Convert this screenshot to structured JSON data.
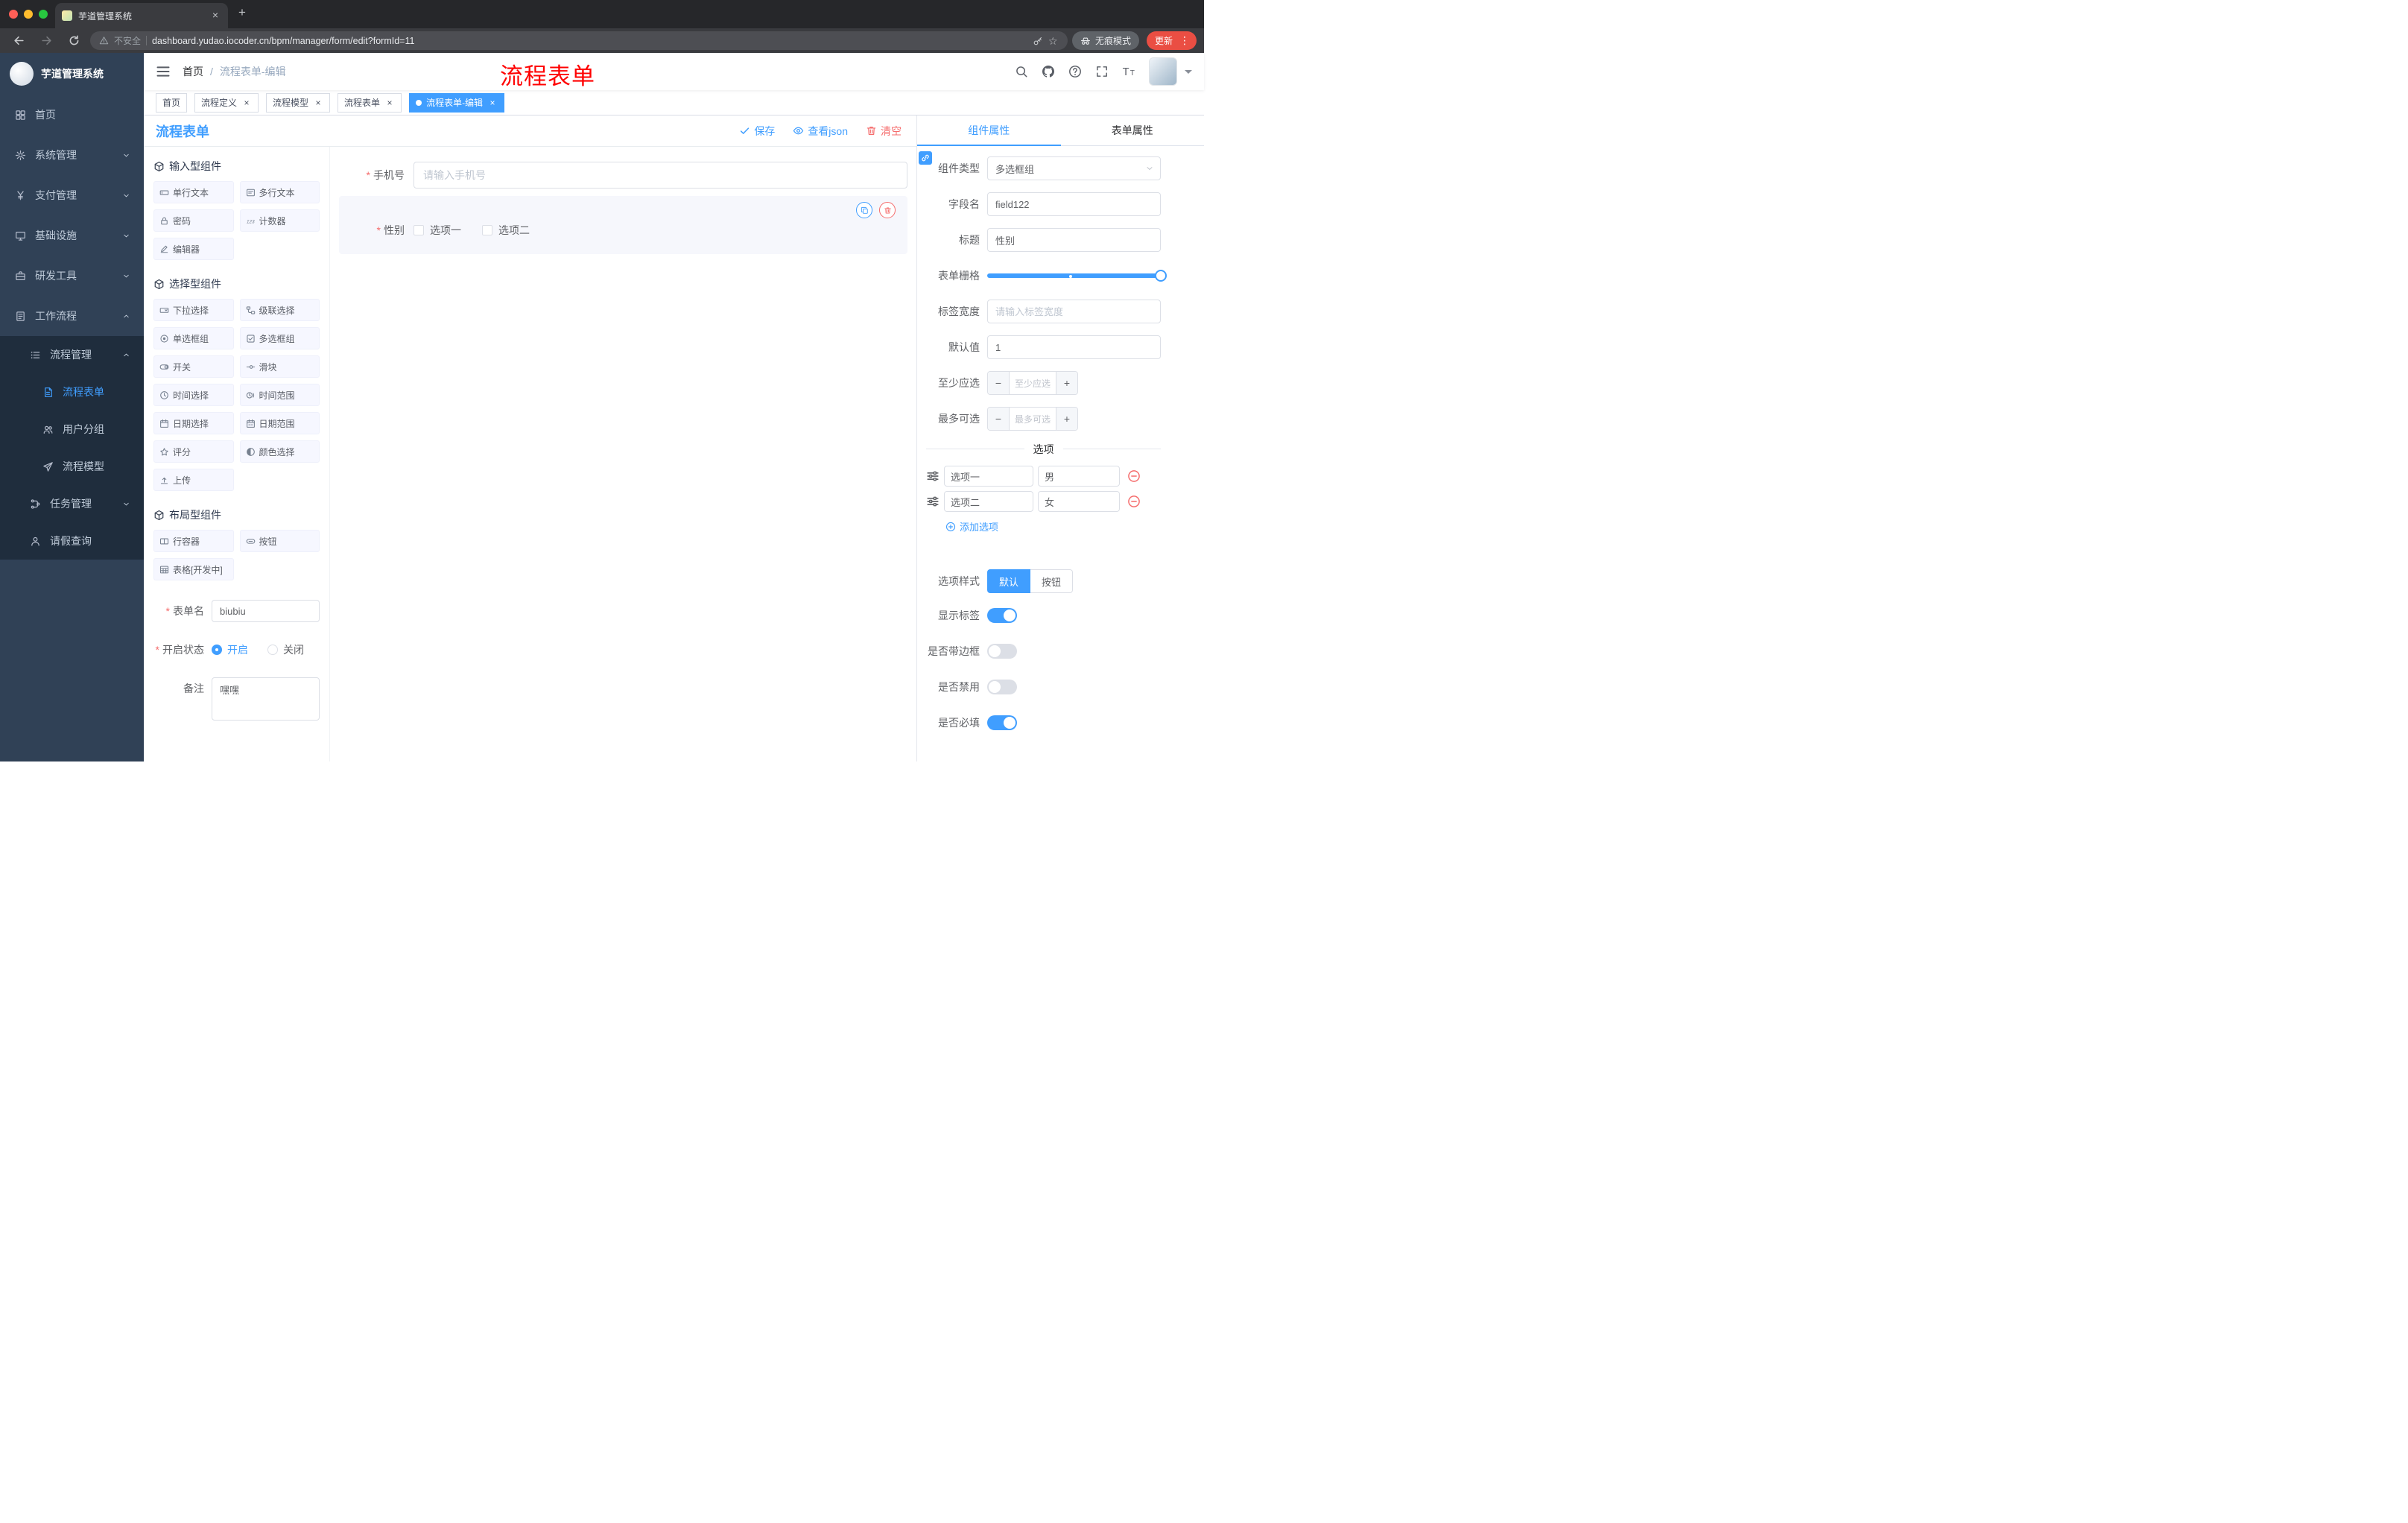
{
  "browser": {
    "tab_title": "芋道管理系统",
    "security_label": "不安全",
    "url": "dashboard.yudao.iocoder.cn/bpm/manager/form/edit?formId=11",
    "incognito_label": "无痕模式",
    "update_label": "更新"
  },
  "sidebar": {
    "logo_title": "芋道管理系统",
    "menu": [
      {
        "key": "home",
        "label": "首页",
        "icon": "home-icon",
        "level": 1
      },
      {
        "key": "system-management",
        "label": "系统管理",
        "icon": "gear-icon",
        "level": 1,
        "arrow": "down"
      },
      {
        "key": "payment-management",
        "label": "支付管理",
        "icon": "yen-icon",
        "level": 1,
        "arrow": "down"
      },
      {
        "key": "infrastructure",
        "label": "基础设施",
        "icon": "monitor-icon",
        "level": 1,
        "arrow": "down"
      },
      {
        "key": "dev-tools",
        "label": "研发工具",
        "icon": "toolbox-icon",
        "level": 1,
        "arrow": "down"
      },
      {
        "key": "workflow",
        "label": "工作流程",
        "icon": "workflow-icon",
        "level": 1,
        "arrow": "up"
      },
      {
        "key": "process-management",
        "label": "流程管理",
        "icon": "list-icon",
        "level": 2,
        "arrow": "up"
      },
      {
        "key": "process-form",
        "label": "流程表单",
        "icon": "document-icon",
        "level": 3,
        "active": true
      },
      {
        "key": "user-group",
        "label": "用户分组",
        "icon": "users-icon",
        "level": 3
      },
      {
        "key": "process-model",
        "label": "流程模型",
        "icon": "send-icon",
        "level": 3
      },
      {
        "key": "task-management",
        "label": "任务管理",
        "icon": "tree-icon",
        "level": 2,
        "arrow": "down"
      },
      {
        "key": "leave-query",
        "label": "请假查询",
        "icon": "user-icon",
        "level": 2
      }
    ]
  },
  "header": {
    "breadcrumb": [
      "首页",
      "流程表单-编辑"
    ],
    "annotation": "流程表单"
  },
  "tags": [
    {
      "key": "home",
      "label": "首页",
      "closable": false,
      "active": false
    },
    {
      "key": "process-definition",
      "label": "流程定义",
      "closable": true,
      "active": false
    },
    {
      "key": "process-model",
      "label": "流程模型",
      "closable": true,
      "active": false
    },
    {
      "key": "process-form",
      "label": "流程表单",
      "closable": true,
      "active": false
    },
    {
      "key": "process-form-edit",
      "label": "流程表单-编辑",
      "closable": true,
      "active": true
    }
  ],
  "designer": {
    "title": "流程表单",
    "actions": {
      "save": "保存",
      "view_json": "查看json",
      "clear": "清空"
    },
    "palette": [
      {
        "title": "输入型组件",
        "items": [
          {
            "label": "单行文本",
            "icon": "input-icon"
          },
          {
            "label": "多行文本",
            "icon": "textarea-icon"
          },
          {
            "label": "密码",
            "icon": "password-icon"
          },
          {
            "label": "计数器",
            "icon": "counter-icon"
          },
          {
            "label": "编辑器",
            "icon": "editor-icon"
          }
        ]
      },
      {
        "title": "选择型组件",
        "items": [
          {
            "label": "下拉选择",
            "icon": "select-icon"
          },
          {
            "label": "级联选择",
            "icon": "cascader-icon"
          },
          {
            "label": "单选框组",
            "icon": "radio-icon"
          },
          {
            "label": "多选框组",
            "icon": "checkbox-icon"
          },
          {
            "label": "开关",
            "icon": "switch-icon"
          },
          {
            "label": "滑块",
            "icon": "slider-icon"
          },
          {
            "label": "时间选择",
            "icon": "time-icon"
          },
          {
            "label": "时间范围",
            "icon": "time-range-icon"
          },
          {
            "label": "日期选择",
            "icon": "date-icon"
          },
          {
            "label": "日期范围",
            "icon": "date-range-icon"
          },
          {
            "label": "评分",
            "icon": "rate-icon"
          },
          {
            "label": "颜色选择",
            "icon": "color-icon"
          },
          {
            "label": "上传",
            "icon": "upload-icon"
          }
        ]
      },
      {
        "title": "布局型组件",
        "items": [
          {
            "label": "行容器",
            "icon": "row-icon"
          },
          {
            "label": "按钮",
            "icon": "button-icon"
          },
          {
            "label": "表格[开发中]",
            "icon": "table-icon"
          }
        ]
      }
    ],
    "meta": {
      "form_name_label": "表单名",
      "form_name_value": "biubiu",
      "status_label": "开启状态",
      "status_on": "开启",
      "status_off": "关闭",
      "remark_label": "备注",
      "remark_value": "嘿嘿"
    },
    "canvas": {
      "phone": {
        "label": "手机号",
        "placeholder": "请输入手机号"
      },
      "gender": {
        "label": "性别",
        "options": [
          "选项一",
          "选项二"
        ]
      }
    }
  },
  "props": {
    "tabs": [
      "组件属性",
      "表单属性"
    ],
    "active_tab": 0,
    "fields": {
      "component_type_label": "组件类型",
      "component_type_value": "多选框组",
      "field_name_label": "字段名",
      "field_name_value": "field122",
      "title_label": "标题",
      "title_value": "性别",
      "grid_label": "表单栅格",
      "label_width_label": "标签宽度",
      "label_width_placeholder": "请输入标签宽度",
      "default_label": "默认值",
      "default_value": "1",
      "min_label": "至少应选",
      "min_placeholder": "至少应选",
      "max_label": "最多可选",
      "max_placeholder": "最多可选"
    },
    "grid_slider": {
      "handle_pct": 100,
      "stop_pct": 47
    },
    "options_divider": "选项",
    "options": [
      {
        "value": "选项一",
        "label": "男"
      },
      {
        "value": "选项二",
        "label": "女"
      }
    ],
    "add_option": "添加选项",
    "style_label": "选项样式",
    "style_options": [
      "默认",
      "按钮"
    ],
    "style_active": 0,
    "switches": [
      {
        "key": "show-label",
        "label": "显示标签",
        "on": true
      },
      {
        "key": "with-border",
        "label": "是否带边框",
        "on": false
      },
      {
        "key": "disabled",
        "label": "是否禁用",
        "on": false
      },
      {
        "key": "required",
        "label": "是否必填",
        "on": true
      }
    ]
  },
  "colors": {
    "accent": "#409EFF",
    "danger": "#F56C6C",
    "annotation": "#FF0000",
    "sidebar": "#304156",
    "submenu": "#1F2D3D"
  }
}
